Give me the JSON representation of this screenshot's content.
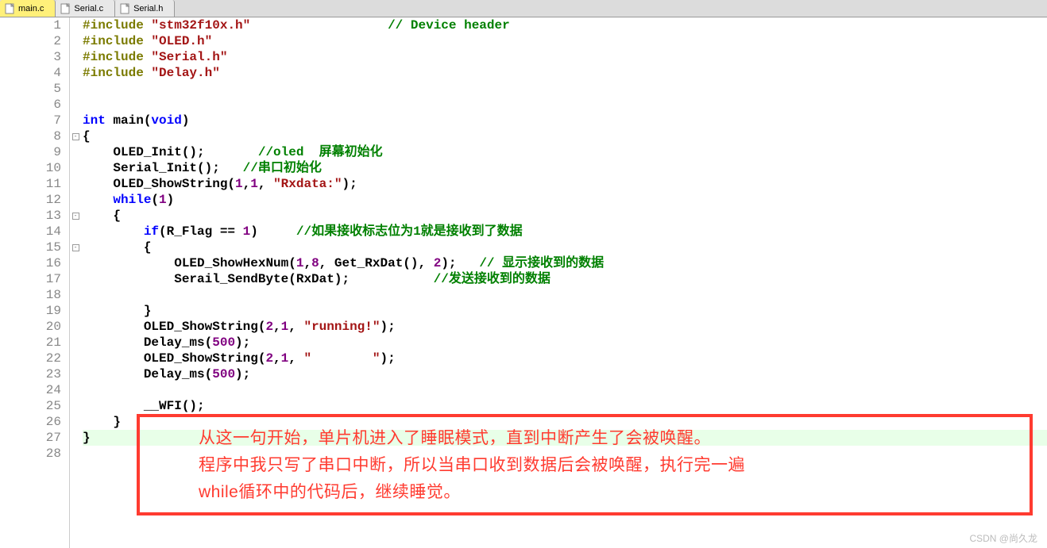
{
  "tabs": [
    {
      "label": "main.c",
      "active": true
    },
    {
      "label": "Serial.c",
      "active": false
    },
    {
      "label": "Serial.h",
      "active": false
    }
  ],
  "gutter": {
    "start": 1,
    "end": 28
  },
  "fold_markers": {
    "8": "-",
    "13": "-",
    "15": "-"
  },
  "code_lines": [
    {
      "n": 1,
      "tokens": [
        [
          "kw-pp",
          "#include "
        ],
        [
          "kw-str",
          "\"stm32f10x.h\""
        ],
        [
          "",
          "                  "
        ],
        [
          "kw-cmt",
          "// Device header"
        ]
      ]
    },
    {
      "n": 2,
      "tokens": [
        [
          "kw-pp",
          "#include "
        ],
        [
          "kw-str",
          "\"OLED.h\""
        ]
      ]
    },
    {
      "n": 3,
      "tokens": [
        [
          "kw-pp",
          "#include "
        ],
        [
          "kw-str",
          "\"Serial.h\""
        ]
      ]
    },
    {
      "n": 4,
      "tokens": [
        [
          "kw-pp",
          "#include "
        ],
        [
          "kw-str",
          "\"Delay.h\""
        ]
      ]
    },
    {
      "n": 5,
      "tokens": [
        [
          "",
          ""
        ]
      ]
    },
    {
      "n": 6,
      "tokens": [
        [
          "",
          ""
        ]
      ]
    },
    {
      "n": 7,
      "tokens": [
        [
          "kw-type",
          "int"
        ],
        [
          "",
          " main("
        ],
        [
          "kw-type",
          "void"
        ],
        [
          "",
          ")"
        ]
      ]
    },
    {
      "n": 8,
      "tokens": [
        [
          "",
          "{"
        ]
      ]
    },
    {
      "n": 9,
      "tokens": [
        [
          "",
          "    OLED_Init();       "
        ],
        [
          "kw-cmt",
          "//oled  屏幕初始化"
        ]
      ]
    },
    {
      "n": 10,
      "tokens": [
        [
          "",
          "    Serial_Init();   "
        ],
        [
          "kw-cmt",
          "//串口初始化"
        ]
      ]
    },
    {
      "n": 11,
      "tokens": [
        [
          "",
          "    OLED_ShowString("
        ],
        [
          "kw-num",
          "1"
        ],
        [
          "",
          ","
        ],
        [
          "kw-num",
          "1"
        ],
        [
          "",
          ", "
        ],
        [
          "kw-str",
          "\"Rxdata:\""
        ],
        [
          "",
          ");"
        ]
      ]
    },
    {
      "n": 12,
      "tokens": [
        [
          "",
          "    "
        ],
        [
          "kw-type",
          "while"
        ],
        [
          "",
          "("
        ],
        [
          "kw-num",
          "1"
        ],
        [
          "",
          ")"
        ]
      ]
    },
    {
      "n": 13,
      "tokens": [
        [
          "",
          "    {"
        ]
      ]
    },
    {
      "n": 14,
      "tokens": [
        [
          "",
          "        "
        ],
        [
          "kw-type",
          "if"
        ],
        [
          "",
          "(R_Flag == "
        ],
        [
          "kw-num",
          "1"
        ],
        [
          "",
          ")     "
        ],
        [
          "kw-cmt",
          "//如果接收标志位为1就是接收到了数据"
        ]
      ]
    },
    {
      "n": 15,
      "tokens": [
        [
          "",
          "        {"
        ]
      ]
    },
    {
      "n": 16,
      "tokens": [
        [
          "",
          "            OLED_ShowHexNum("
        ],
        [
          "kw-num",
          "1"
        ],
        [
          "",
          ","
        ],
        [
          "kw-num",
          "8"
        ],
        [
          "",
          ", Get_RxDat(), "
        ],
        [
          "kw-num",
          "2"
        ],
        [
          "",
          ");   "
        ],
        [
          "kw-cmt",
          "// 显示接收到的数据"
        ]
      ]
    },
    {
      "n": 17,
      "tokens": [
        [
          "",
          "            Serail_SendByte(RxDat);           "
        ],
        [
          "kw-cmt",
          "//发送接收到的数据"
        ]
      ]
    },
    {
      "n": 18,
      "tokens": [
        [
          "",
          ""
        ]
      ]
    },
    {
      "n": 19,
      "tokens": [
        [
          "",
          "        }"
        ]
      ]
    },
    {
      "n": 20,
      "tokens": [
        [
          "",
          "        OLED_ShowString("
        ],
        [
          "kw-num",
          "2"
        ],
        [
          "",
          ","
        ],
        [
          "kw-num",
          "1"
        ],
        [
          "",
          ", "
        ],
        [
          "kw-str",
          "\"running!\""
        ],
        [
          "",
          ");"
        ]
      ]
    },
    {
      "n": 21,
      "tokens": [
        [
          "",
          "        Delay_ms("
        ],
        [
          "kw-num",
          "500"
        ],
        [
          "",
          ");"
        ]
      ]
    },
    {
      "n": 22,
      "tokens": [
        [
          "",
          "        OLED_ShowString("
        ],
        [
          "kw-num",
          "2"
        ],
        [
          "",
          ","
        ],
        [
          "kw-num",
          "1"
        ],
        [
          "",
          ", "
        ],
        [
          "kw-str",
          "\"        \""
        ],
        [
          "",
          ");"
        ]
      ]
    },
    {
      "n": 23,
      "tokens": [
        [
          "",
          "        Delay_ms("
        ],
        [
          "kw-num",
          "500"
        ],
        [
          "",
          ");"
        ]
      ]
    },
    {
      "n": 24,
      "tokens": [
        [
          "",
          ""
        ]
      ]
    },
    {
      "n": 25,
      "tokens": [
        [
          "",
          "        __WFI();"
        ]
      ]
    },
    {
      "n": 26,
      "tokens": [
        [
          "",
          "    }"
        ]
      ]
    },
    {
      "n": 27,
      "tokens": [
        [
          "",
          "}"
        ]
      ],
      "hl": true
    },
    {
      "n": 28,
      "tokens": [
        [
          "",
          ""
        ]
      ]
    }
  ],
  "annotation": {
    "line1": "从这一句开始，单片机进入了睡眠模式，直到中断产生了会被唤醒。",
    "line2": "程序中我只写了串口中断，所以当串口收到数据后会被唤醒，执行完一遍",
    "line3": "while循环中的代码后，继续睡觉。"
  },
  "watermark": "CSDN @尚久龙",
  "colors": {
    "annotation_red": "#ff3b30",
    "tab_active_bg": "#fff07a"
  }
}
